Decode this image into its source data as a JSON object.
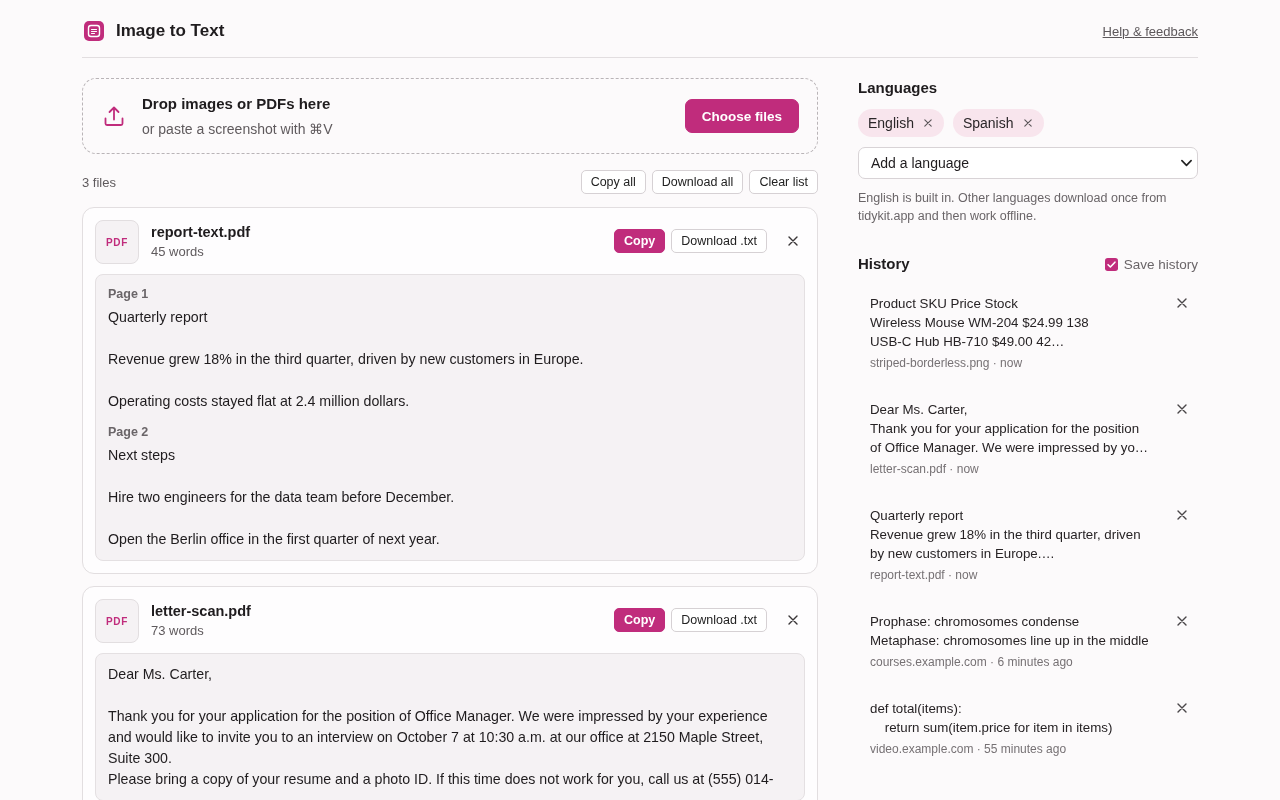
{
  "header": {
    "title": "Image to Text",
    "help_link": "Help & feedback"
  },
  "drop_zone": {
    "title": "Drop images or PDFs here",
    "subtitle": "or paste a screenshot with ⌘V",
    "button": "Choose files"
  },
  "file_list": {
    "count": "3 files",
    "actions": [
      "Copy all",
      "Download all",
      "Clear list"
    ]
  },
  "files": [
    {
      "type_badge": "PDF",
      "name": "report-text.pdf",
      "word_count": "45 words",
      "actions": [
        {
          "label": "Copy",
          "kind": "primary"
        },
        {
          "label": "Download .txt",
          "kind": "secondary"
        }
      ],
      "sections": [
        {
          "page_label": "Page 1",
          "text": "Quarterly report\n\nRevenue grew 18% in the third quarter, driven by new customers in Europe.\n\nOperating costs stayed flat at 2.4 million dollars."
        },
        {
          "page_label": "Page 2",
          "text": "Next steps\n\nHire two engineers for the data team before December.\n\nOpen the Berlin office in the first quarter of next year."
        }
      ]
    },
    {
      "type_badge": "PDF",
      "name": "letter-scan.pdf",
      "word_count": "73 words",
      "actions": [
        {
          "label": "Copy",
          "kind": "primary"
        },
        {
          "label": "Download .txt",
          "kind": "secondary"
        }
      ],
      "sections": [
        {
          "text": "Dear Ms. Carter,\n\nThank you for your application for the position of Office Manager. We were impressed by your experience and would like to invite you to an interview on October 7 at 10:30 a.m. at our office at 2150 Maple Street, Suite 300.\nPlease bring a copy of your resume and a photo ID. If this time does not work for you, call us at (555) 014-"
        }
      ]
    }
  ],
  "languages": {
    "title": "Languages",
    "chips": [
      "English",
      "Spanish"
    ],
    "dropdown": {
      "placeholder": "Add a language"
    },
    "note": "English is built in. Other languages download once from tidykit.app and then work offline."
  },
  "history": {
    "title": "History",
    "save_history": {
      "label": "Save history",
      "checked": true
    },
    "items": [
      {
        "snippet": "Product SKU Price Stock\nWireless Mouse WM-204 $24.99 138\nUSB-C Hub HB-710 $49.00 42…",
        "meta": "striped-borderless.png · now"
      },
      {
        "snippet": "Dear Ms. Carter,\nThank you for your application for the position of Office Manager. We were impressed by yo…",
        "meta": "letter-scan.pdf · now"
      },
      {
        "snippet": "Quarterly report\nRevenue grew 18% in the third quarter, driven by new customers in Europe.…",
        "meta": "report-text.pdf · now"
      },
      {
        "snippet": "Prophase: chromosomes condense\nMetaphase: chromosomes line up in the middle",
        "meta": "courses.example.com · 6 minutes ago"
      },
      {
        "snippet": "def total(items):\n    return sum(item.price for item in items)",
        "meta": "video.example.com · 55 minutes ago"
      }
    ]
  }
}
